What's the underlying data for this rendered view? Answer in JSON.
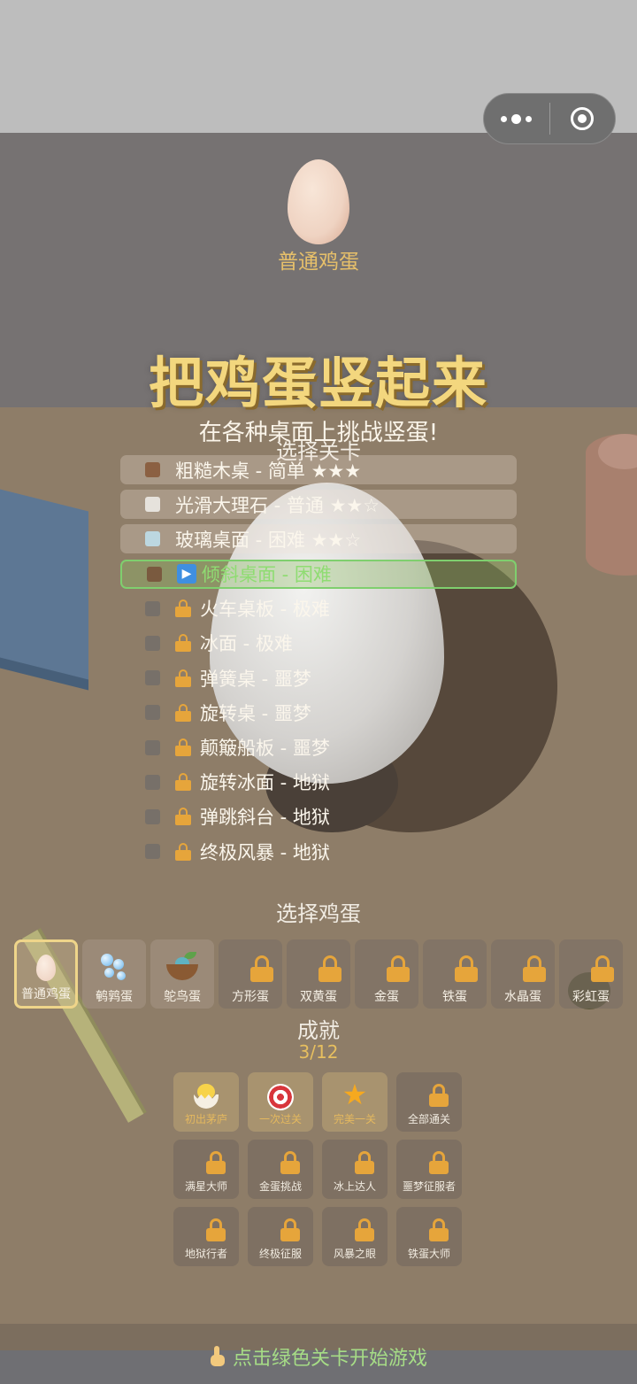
{
  "header": {
    "current_egg_label": "普通鸡蛋",
    "title": "把鸡蛋竖起来",
    "subtitle": "在各种桌面上挑战竖蛋!"
  },
  "colors": {
    "title": "#f3d77e",
    "current_level": "#8fdc72",
    "lock": "#e6a53b",
    "achievement_done": "#e4b85e"
  },
  "levels": {
    "heading": "选择关卡",
    "items": [
      {
        "label": "粗糙木桌 - 简单 ★★★",
        "swatch": "#8b6042",
        "state": "unlocked"
      },
      {
        "label": "光滑大理石 - 普通 ★★☆",
        "swatch": "#e6e2dc",
        "state": "unlocked"
      },
      {
        "label": "玻璃桌面 - 困难 ★★☆",
        "swatch": "#bcd7e0",
        "state": "unlocked"
      },
      {
        "label": "倾斜桌面 - 困难",
        "swatch": "#7a5a3f",
        "state": "current",
        "icon": "play-icon"
      },
      {
        "label": "火车桌板 - 极难",
        "swatch": "#777069",
        "state": "locked",
        "icon": "lock-icon"
      },
      {
        "label": "冰面 - 极难",
        "swatch": "#777069",
        "state": "locked",
        "icon": "lock-icon"
      },
      {
        "label": "弹簧桌 - 噩梦",
        "swatch": "#777069",
        "state": "locked",
        "icon": "lock-icon"
      },
      {
        "label": "旋转桌 - 噩梦",
        "swatch": "#777069",
        "state": "locked",
        "icon": "lock-icon"
      },
      {
        "label": "颠簸船板 - 噩梦",
        "swatch": "#777069",
        "state": "locked",
        "icon": "lock-icon"
      },
      {
        "label": "旋转冰面 - 地狱",
        "swatch": "#777069",
        "state": "locked",
        "icon": "lock-icon"
      },
      {
        "label": "弹跳斜台 - 地狱",
        "swatch": "#777069",
        "state": "locked",
        "icon": "lock-icon"
      },
      {
        "label": "终极风暴 - 地狱",
        "swatch": "#777069",
        "state": "locked",
        "icon": "lock-icon"
      }
    ]
  },
  "eggs": {
    "heading": "选择鸡蛋",
    "items": [
      {
        "label": "普通鸡蛋",
        "icon": "egg-icon",
        "state": "selected"
      },
      {
        "label": "鹌鹑蛋",
        "icon": "bubbles-icon",
        "state": "unlocked"
      },
      {
        "label": "鸵鸟蛋",
        "icon": "nest-icon",
        "state": "unlocked"
      },
      {
        "label": "方形蛋",
        "icon": "lock-icon",
        "state": "locked"
      },
      {
        "label": "双黄蛋",
        "icon": "lock-icon",
        "state": "locked"
      },
      {
        "label": "金蛋",
        "icon": "lock-icon",
        "state": "locked"
      },
      {
        "label": "铁蛋",
        "icon": "lock-icon",
        "state": "locked"
      },
      {
        "label": "水晶蛋",
        "icon": "lock-icon",
        "state": "locked"
      },
      {
        "label": "彩虹蛋",
        "icon": "lock-icon",
        "state": "locked"
      }
    ]
  },
  "achievements": {
    "heading": "成就",
    "count": "3/12",
    "items": [
      {
        "label": "初出茅庐",
        "icon": "chick-icon",
        "done": true
      },
      {
        "label": "一次过关",
        "icon": "target-icon",
        "done": true
      },
      {
        "label": "完美一关",
        "icon": "star-icon",
        "done": true
      },
      {
        "label": "全部通关",
        "icon": "lock-icon",
        "done": false
      },
      {
        "label": "满星大师",
        "icon": "lock-icon",
        "done": false
      },
      {
        "label": "金蛋挑战",
        "icon": "lock-icon",
        "done": false
      },
      {
        "label": "冰上达人",
        "icon": "lock-icon",
        "done": false
      },
      {
        "label": "噩梦征服者",
        "icon": "lock-icon",
        "done": false
      },
      {
        "label": "地狱行者",
        "icon": "lock-icon",
        "done": false
      },
      {
        "label": "终极征服",
        "icon": "lock-icon",
        "done": false
      },
      {
        "label": "风暴之眼",
        "icon": "lock-icon",
        "done": false
      },
      {
        "label": "铁蛋大师",
        "icon": "lock-icon",
        "done": false
      }
    ]
  },
  "footer": {
    "hint": "点击绿色关卡开始游戏",
    "icon": "pointing-hand-icon"
  },
  "capsule": {
    "more_icon": "more-dots-icon",
    "close_icon": "close-circle-icon"
  }
}
